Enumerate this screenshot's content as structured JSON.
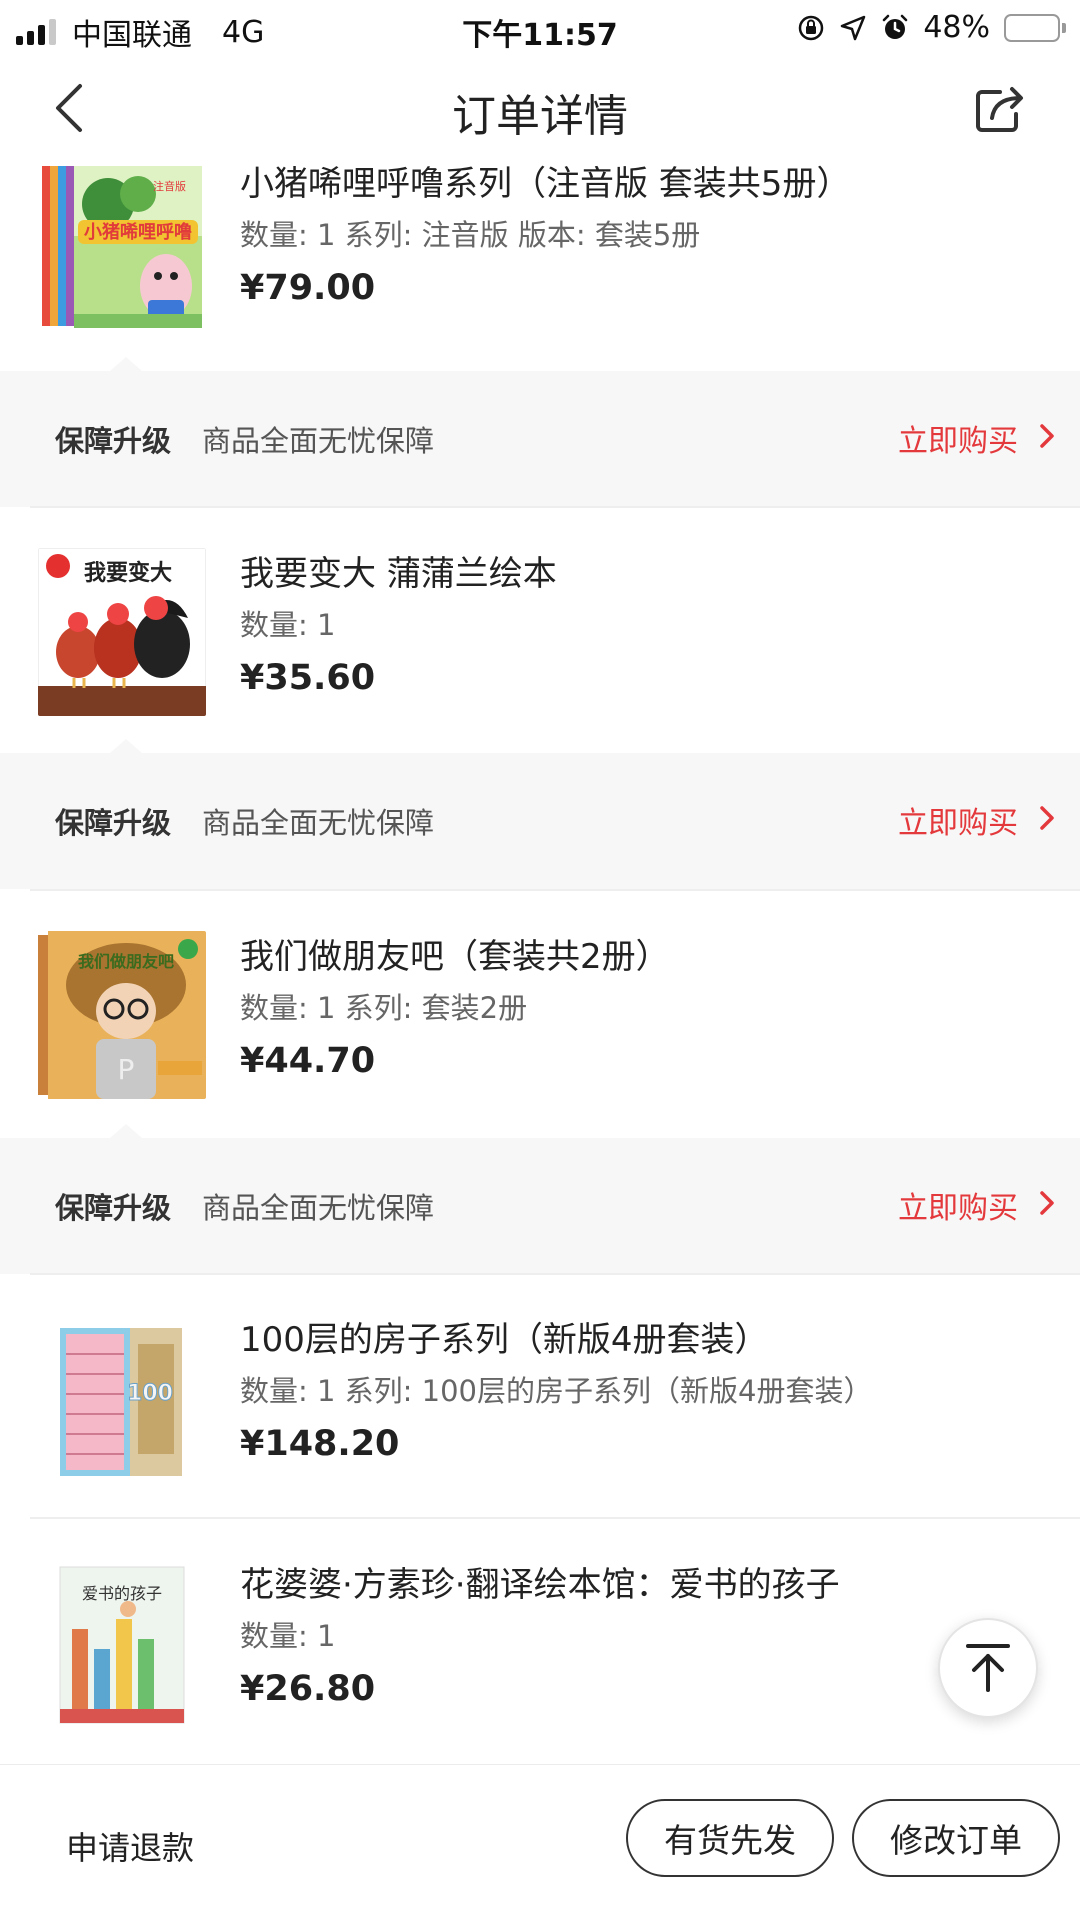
{
  "status_bar": {
    "carrier": "中国联通",
    "network": "4G",
    "time": "下午11:57",
    "battery": "48%",
    "battery_level": 0.48
  },
  "header": {
    "title": "订单详情"
  },
  "guarantee_common": {
    "label": "保障升级",
    "description": "商品全面无忧保障",
    "action": "立即购买"
  },
  "products": [
    {
      "title": "小猪唏哩呼噜系列（注音版 套装共5册）",
      "meta": "数量: 1 系列: 注音版 版本: 套装5册",
      "price": "¥79.00",
      "cover_text": "小猪唏哩呼噜",
      "cover_badge": "注音版"
    },
    {
      "title": "我要变大 蒲蒲兰绘本",
      "meta": "数量: 1",
      "price": "¥35.60",
      "cover_text": "我要变大"
    },
    {
      "title": "我们做朋友吧（套装共2册）",
      "meta": "数量: 1 系列: 套装2册",
      "price": "¥44.70",
      "cover_text": "我们做朋友吧"
    },
    {
      "title": "100层的房子系列（新版4册套装）",
      "meta": "数量: 1 系列: 100层的房子系列（新版4册套装）",
      "price": "¥148.20",
      "cover_text": "100"
    },
    {
      "title": "花婆婆·方素珍·翻译绘本馆：爱书的孩子",
      "meta": "数量: 1",
      "price": "¥26.80",
      "cover_text": "爱书的孩子"
    }
  ],
  "bottom_bar": {
    "refund": "申请退款",
    "ship_first": "有货先发",
    "modify_order": "修改订单"
  },
  "colors": {
    "accent_red": "#e4393c",
    "battery_yellow": "#f5c518",
    "guarantee_bg": "#f7f7f7"
  },
  "icons": [
    "signal-icon",
    "orientation-lock-icon",
    "location-icon",
    "alarm-icon",
    "battery-icon",
    "back-icon",
    "share-icon",
    "chevron-right-icon",
    "back-to-top-icon"
  ]
}
